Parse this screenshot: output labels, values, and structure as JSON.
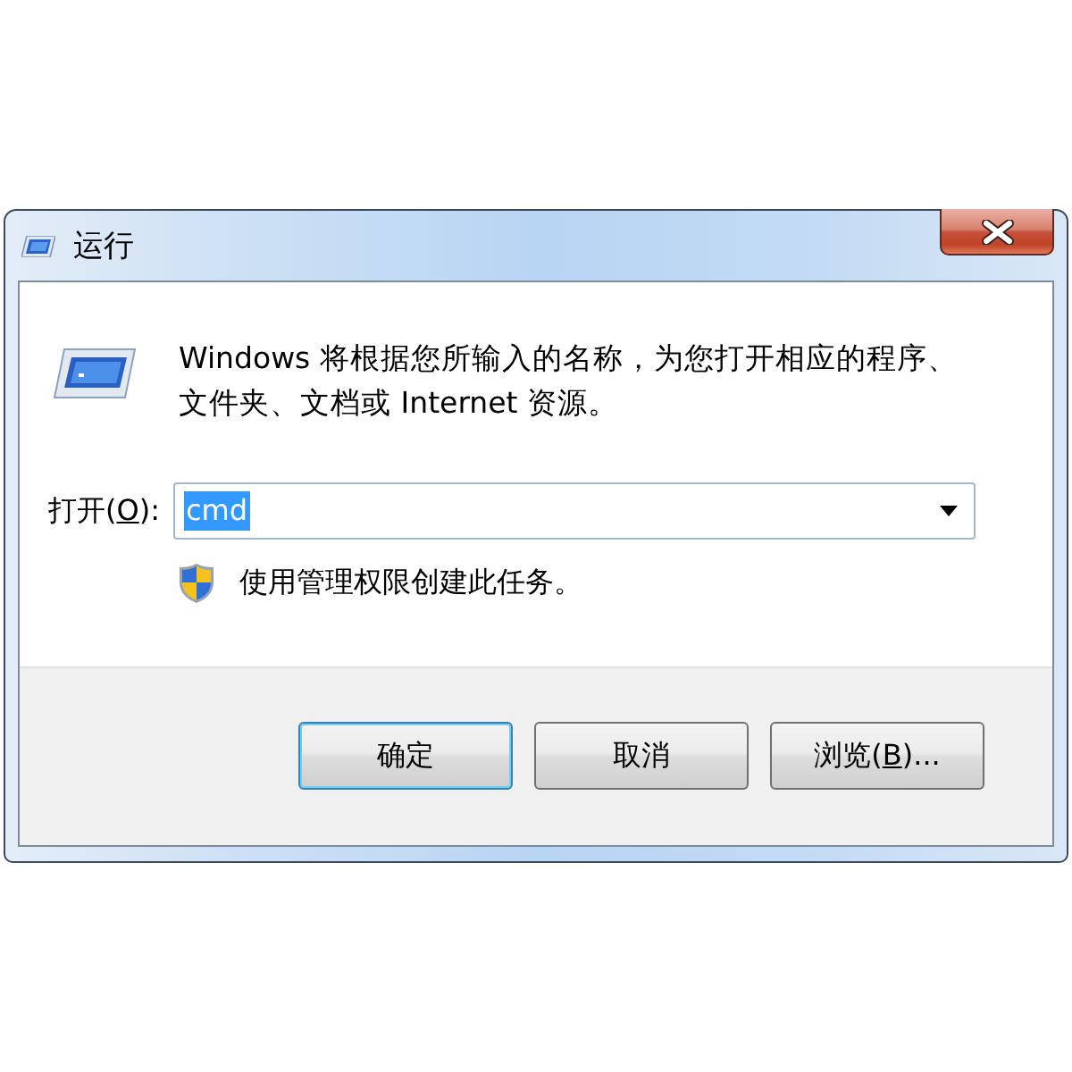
{
  "window": {
    "title": "运行"
  },
  "description": "Windows 将根据您所输入的名称，为您打开相应的程序、文件夹、文档或 Internet 资源。",
  "open_field": {
    "label": {
      "text": "打开(",
      "access_key": "O",
      "text_after": "):"
    },
    "value": "cmd",
    "text_selected": true
  },
  "admin_note": "使用管理权限创建此任务。",
  "buttons": [
    {
      "label": {
        "text": "确定"
      },
      "default": true
    },
    {
      "label": {
        "text": "取消"
      },
      "default": false
    },
    {
      "label": {
        "text": "浏览(",
        "access_key": "B",
        "text_after": ")..."
      },
      "default": false
    }
  ]
}
